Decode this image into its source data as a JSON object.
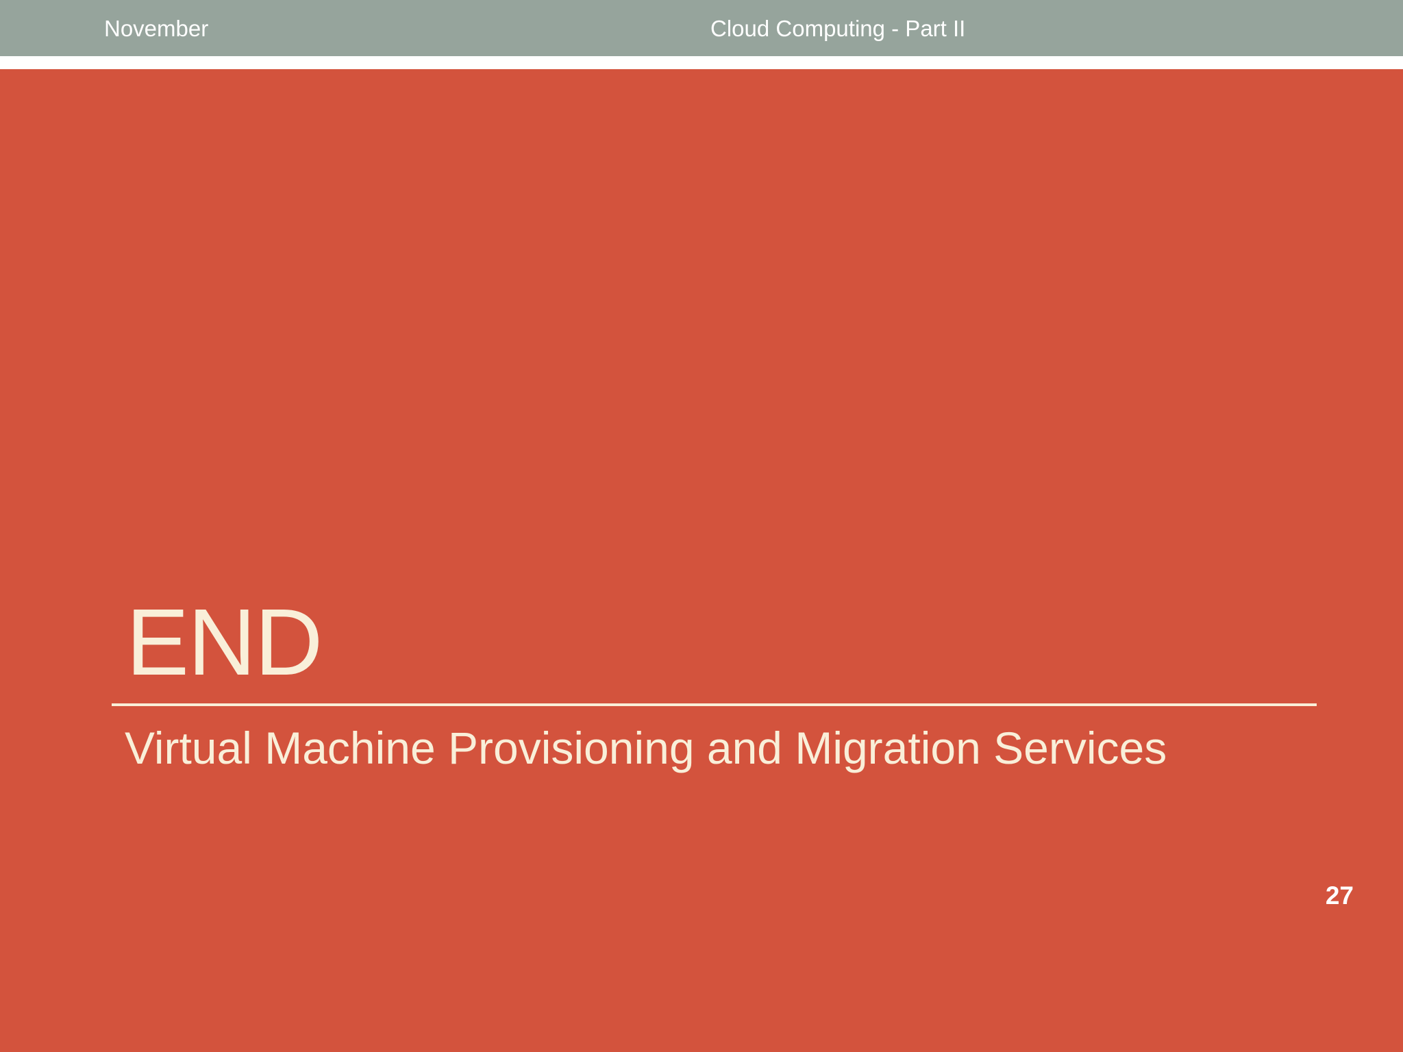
{
  "header": {
    "left_text": "November",
    "center_text": "Cloud Computing - Part II"
  },
  "slide": {
    "title": "END",
    "subtitle": "Virtual Machine Provisioning and Migration Services",
    "page_number": "27"
  },
  "colors": {
    "header_bar": "#96a49c",
    "main_panel": "#d3533d",
    "text_cream": "#f9efd9",
    "text_white": "#ffffff"
  }
}
